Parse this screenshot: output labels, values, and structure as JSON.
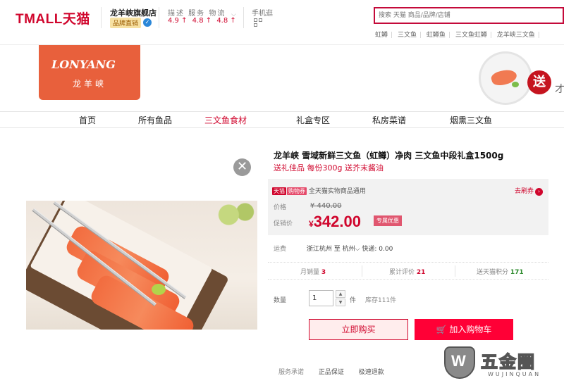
{
  "header": {
    "logo_text": "TMALL天猫",
    "shop_name": "龙羊峡旗舰店",
    "shop_badge": "品牌直销",
    "rating_title": "描述 服务 物流",
    "ratings": [
      "4.9 ↑",
      "4.8 ↑",
      "4.8 ↑"
    ],
    "mobile_label": "手机逛",
    "search_placeholder": "搜索 天猫 商品/品牌/店铺",
    "hot_words": [
      "虹鳟",
      "三文鱼",
      "虹鳟鱼",
      "三文鱼虹鳟",
      "龙羊峡三文鱼"
    ]
  },
  "banner": {
    "logo_text": "LONYANG",
    "logo_cn": "龙羊峡",
    "seal_text": "送",
    "more_text": "才"
  },
  "nav": {
    "items": [
      "首页",
      "所有鱼品",
      "三文鱼食材",
      "礼盒专区",
      "私房菜谱",
      "烟熏三文鱼"
    ],
    "active_index": 2
  },
  "close_symbol": "✕",
  "product": {
    "title": "龙羊峡 雪域新鲜三文鱼（虹鳟）净肉 三文鱼中段礼盒1500g",
    "subtitle": "送礼佳品 每份300g 送芥末酱油",
    "tag1": "天猫",
    "tag2": "购物券",
    "coupon_note": "全天猫实物商品通用",
    "coupon_link": "去刷券",
    "price_label": "价格",
    "original_price": "¥ 440.00",
    "promo_label": "促销价",
    "currency": "¥",
    "promo_price": "342.00",
    "promo_badge": "专属优惠",
    "shipping_label": "运费",
    "shipping_from": "浙江杭州",
    "shipping_to_word": "至",
    "shipping_to": "杭州",
    "shipping_fee": "快递: 0.00",
    "stats": {
      "monthly_sales_label": "月销量",
      "monthly_sales": "3",
      "reviews_label": "累计评价",
      "reviews": "21",
      "points_label": "送天猫积分",
      "points": "171"
    },
    "qty_label": "数量",
    "qty_value": "1",
    "qty_unit": "件",
    "stock": "库存111件",
    "buy_now": "立即购买",
    "add_cart": "加入购物车",
    "add_cart_icon": "🛒",
    "service_label": "服务承诺",
    "services": [
      "正品保证",
      "极速退款"
    ]
  },
  "watermark": {
    "text": "五金圈",
    "sub": "WUJINQUAN"
  },
  "colors": {
    "brand_red": "#d0062d",
    "cart_red": "#ff0036",
    "logo_orange": "#e8603c"
  }
}
